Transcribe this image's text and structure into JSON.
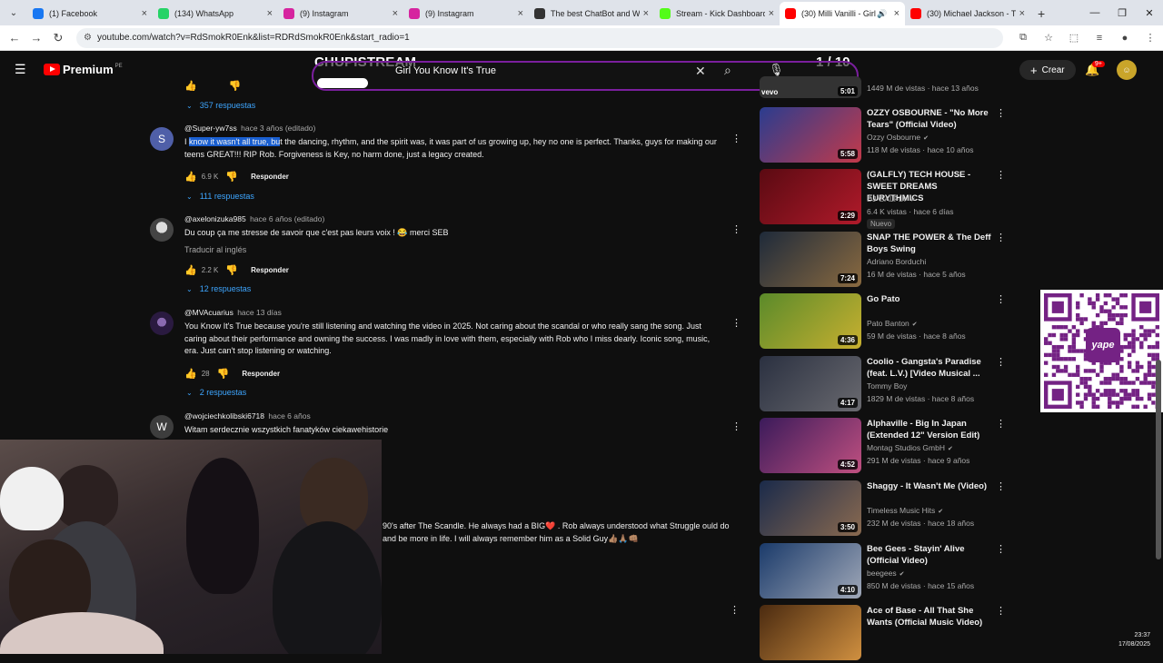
{
  "browser": {
    "tabs": [
      {
        "title": "(1) Facebook",
        "icon": "facebook-icon",
        "color": "#1877f2"
      },
      {
        "title": "(134) WhatsApp",
        "icon": "whatsapp-icon",
        "color": "#25d366"
      },
      {
        "title": "(9) Instagram",
        "icon": "instagram-icon",
        "color": "#d6249f"
      },
      {
        "title": "(9) Instagram",
        "icon": "instagram-icon",
        "color": "#d6249f"
      },
      {
        "title": "The best ChatBot and Wi",
        "icon": "chatbot-icon",
        "color": "#333333"
      },
      {
        "title": "Stream - Kick Dashboard",
        "icon": "kick-icon",
        "color": "#53fc18"
      },
      {
        "title": "(30) Milli Vanilli - Girl",
        "icon": "youtube-icon",
        "color": "#ff0000"
      },
      {
        "title": "(30) Michael Jackson - Th",
        "icon": "youtube-icon",
        "color": "#ff0000"
      }
    ],
    "url": "youtube.com/watch?v=RdSmokR0Enk&list=RDRdSmokR0Enk&start_radio=1"
  },
  "header": {
    "logo_text": "Premium",
    "region": "PE",
    "create_label": "Crear",
    "notification_badge": "9+"
  },
  "overlay": {
    "title": "CHUPISTREAM",
    "search_query": "Girl You Know It's True",
    "queue_counter": "1 / 10"
  },
  "comments": [
    {
      "replies_label": "357 respuestas"
    },
    {
      "author": "@Super-yw7ss",
      "time": "hace 3 años (editado)",
      "avatar_letter": "S",
      "avatar_color": "#4f5fa8",
      "text_pre": "I ",
      "text_highlight": "know it wasn't all true, bu",
      "text_post": "t the dancing, rhythm, and the spirit was, it was part of us growing up, hey no one is perfect. Thanks, guys for making our teens GREAT!!! RIP Rob. Forgiveness is Key, no harm done, just a legacy created.",
      "likes": "6.9 K",
      "reply_label": "Responder",
      "replies_label": "111 respuestas"
    },
    {
      "author": "@axelonizuka985",
      "time": "hace 6 años (editado)",
      "avatar_letter": "",
      "avatar_color": "#555555",
      "text": "Du coup ça me stresse de savoir que c'est pas leurs voix ! 😂 merci SEB",
      "translate_label": "Traducir al inglés",
      "likes": "2.2 K",
      "reply_label": "Responder",
      "replies_label": "12 respuestas"
    },
    {
      "author": "@MVAcuarius",
      "time": "hace 13 días",
      "avatar_letter": "",
      "avatar_color": "#3a2a55",
      "text": "You Know It's True because you're still listening and watching the video in 2025. Not caring about the scandal or who really sang the song. Just caring about their performance and owning the success. I was madly in love with them, especially with Rob who I miss dearly. Iconic song, music, era. Just can't stop listening or watching.",
      "likes": "28",
      "reply_label": "Responder",
      "replies_label": "2 respuestas"
    },
    {
      "author": "@wojciechkolibski6718",
      "time": "hace 6 años",
      "avatar_letter": "W",
      "avatar_color": "#3d3d3d",
      "text": "Witam serdecznie wszystkich fanatyków ciekawehistorie"
    }
  ],
  "partial_comment": {
    "text": "90's after The Scandle. He always had a BIG❤️ . Rob always understood what Struggle ould do and be more in life. I will always remember him as a Solid Guy👍🏽🙏🏽👊🏽"
  },
  "recommendations": [
    {
      "title": "OZZY OSBOURNE - \"No More Tears\" (Official Video)",
      "channel": "Ozzy Osbourne",
      "verified": true,
      "meta": "118 M de vistas · hace 10 años",
      "duration": "5:58",
      "thumb_colors": [
        "#2a3c8f",
        "#c33a4a"
      ]
    },
    {
      "title": "(GALFLY) TECH HOUSE - SWEET DREAMS  EURYTHMICS",
      "channel": "DJ GALFLY",
      "verified": true,
      "meta": "6.4 K vistas · hace 6 días",
      "duration": "2:29",
      "badge": "Nuevo",
      "thumb_colors": [
        "#5a0a12",
        "#b01a2a"
      ]
    },
    {
      "title": "SNAP  THE POWER  & The Deff Boys  Swing",
      "channel": "Adriano Borduchi",
      "verified": false,
      "meta": "16 M de vistas · hace 5 años",
      "duration": "7:24",
      "thumb_colors": [
        "#1e2a3a",
        "#8a6a40"
      ]
    },
    {
      "title": "Go Pato",
      "channel": "Pato Banton",
      "verified": true,
      "meta": "59 M de vistas · hace 8 años",
      "duration": "4:36",
      "thumb_colors": [
        "#5a8a2a",
        "#c8b030"
      ]
    },
    {
      "title": "Coolio - Gangsta's Paradise (feat. L.V.) [Video Musical ...",
      "channel": "Tommy Boy",
      "verified": false,
      "meta": "1829 M de vistas · hace 8 años",
      "duration": "4:17",
      "thumb_colors": [
        "#2a3040",
        "#6a6a70"
      ]
    },
    {
      "title": "Alphaville - Big In Japan (Extended 12\" Version Edit)",
      "channel": "Montag Studios GmbH",
      "verified": true,
      "meta": "291 M de vistas · hace 9 años",
      "duration": "4:52",
      "thumb_colors": [
        "#3a1a5a",
        "#c05080"
      ]
    },
    {
      "title": "Shaggy - It Wasn't Me (Video)",
      "channel": "Timeless Music Hits",
      "verified": true,
      "meta": "232 M de vistas · hace 18 años",
      "duration": "3:50",
      "thumb_colors": [
        "#1a2a4a",
        "#8a6a50"
      ]
    },
    {
      "title": "Bee Gees - Stayin' Alive (Official Video)",
      "channel": "beegees",
      "verified": true,
      "meta": "850 M de vistas · hace 15 años",
      "duration": "4:10",
      "thumb_colors": [
        "#1a3a6a",
        "#a0a8b8"
      ]
    },
    {
      "title": "Ace of Base - All That She Wants (Official Music Video)",
      "channel": "",
      "verified": false,
      "meta": "",
      "duration": "",
      "thumb_colors": [
        "#4a2a10",
        "#d09040"
      ]
    }
  ],
  "rec_partial_top": {
    "meta": "1449 M de vistas · hace 13 años",
    "duration": "5:01",
    "channel_logo": "vevo"
  },
  "qr": {
    "brand": "yape"
  },
  "taskbar": {
    "time": "23:37",
    "date": "17/08/2025"
  }
}
